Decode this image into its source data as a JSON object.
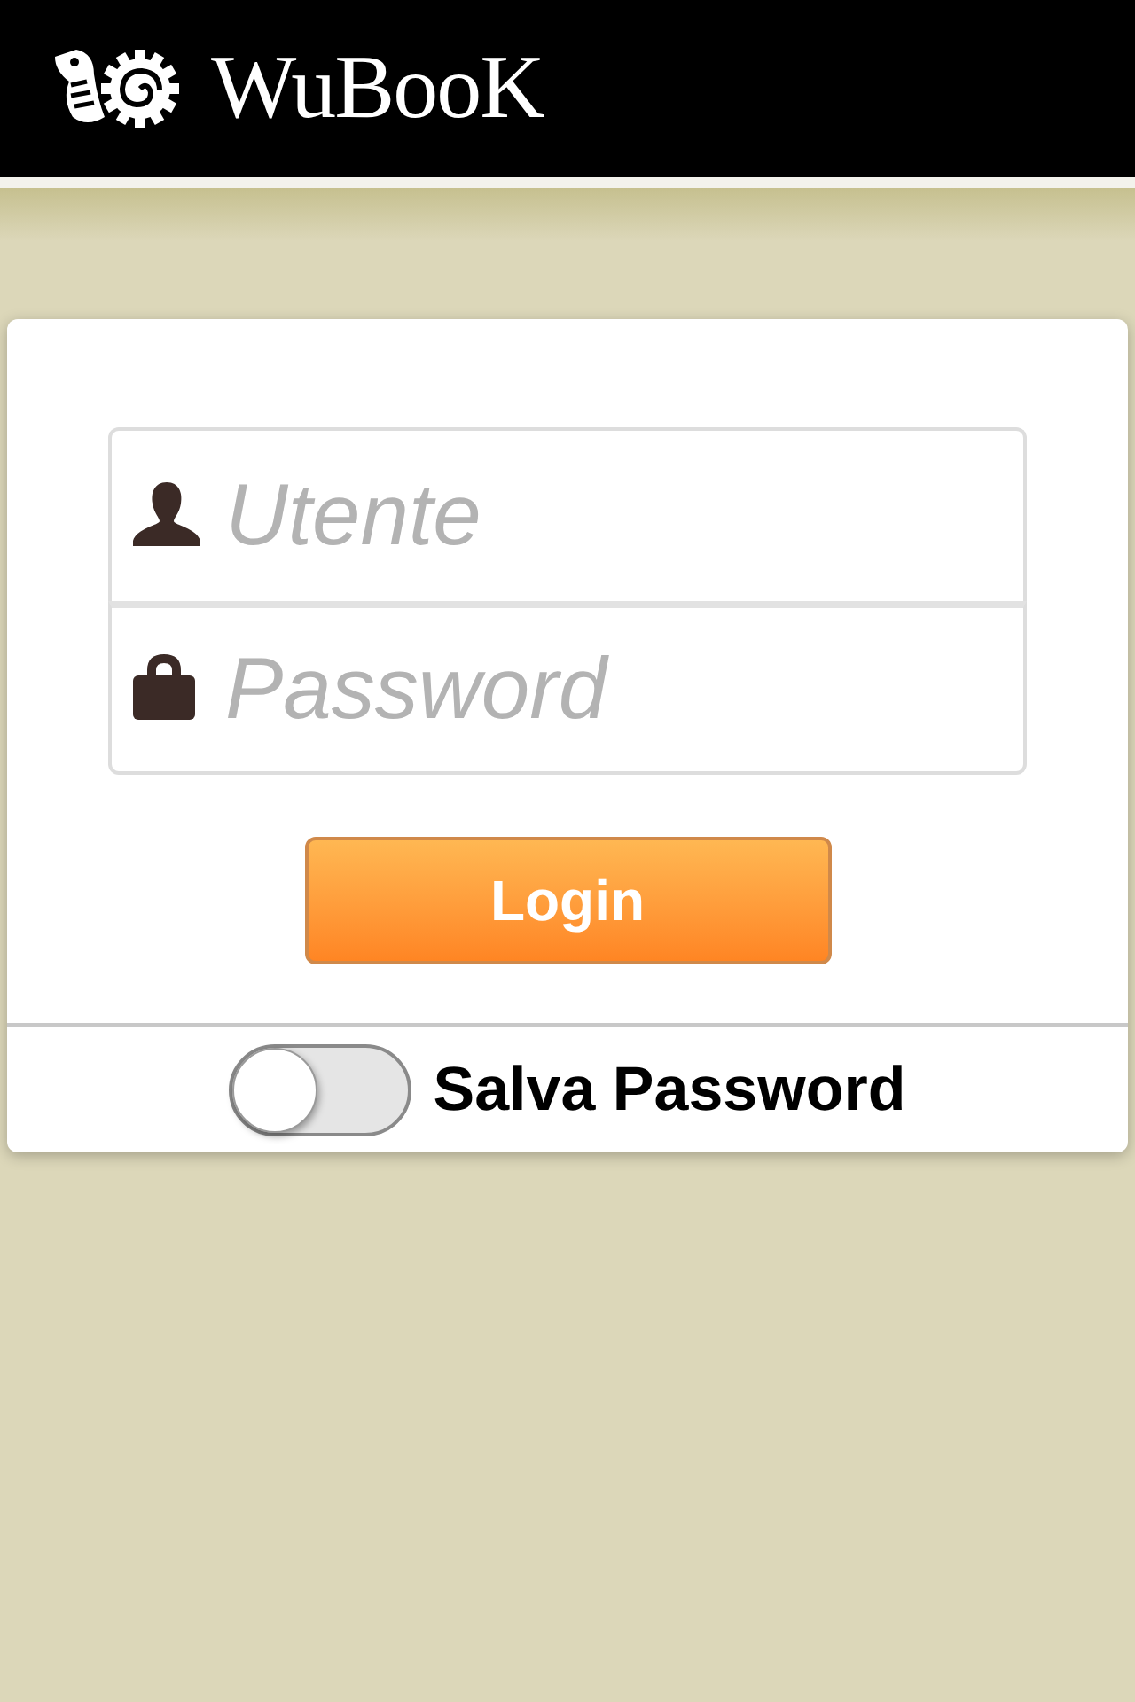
{
  "header": {
    "brand": "WuBooK"
  },
  "login_form": {
    "fields": [
      {
        "kind": "user",
        "placeholder": "Utente"
      },
      {
        "kind": "password",
        "placeholder": "Password"
      }
    ],
    "submit": "Login"
  },
  "remember": {
    "label": "Salva Password",
    "on": false
  }
}
